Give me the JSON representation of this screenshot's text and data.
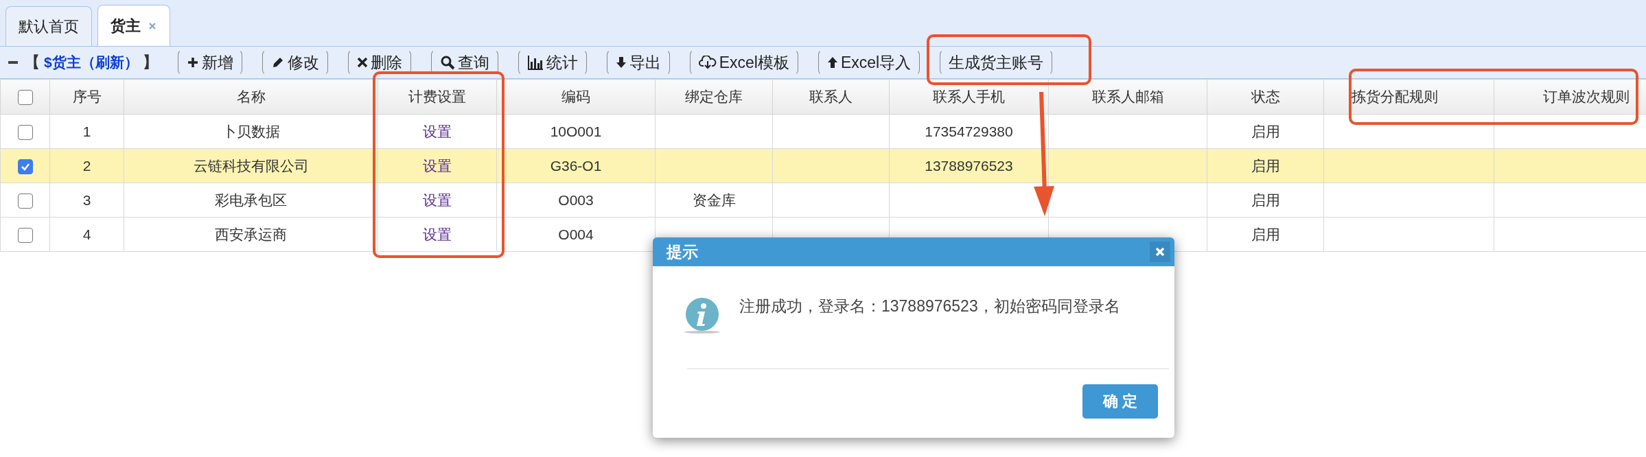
{
  "tabs": [
    {
      "label": "默认首页",
      "selected": false,
      "closable": false
    },
    {
      "label": "货主",
      "selected": true,
      "closable": true
    }
  ],
  "toolbar": {
    "title_open": "【",
    "title": "$货主（刷新）",
    "title_close": "】",
    "buttons": [
      {
        "label": "新增",
        "kind": "plus"
      },
      {
        "label": "修改",
        "kind": "pencil"
      },
      {
        "label": "删除",
        "kind": "cross"
      },
      {
        "label": "查询",
        "kind": "search"
      },
      {
        "label": "统计",
        "kind": "chart"
      },
      {
        "label": "导出",
        "kind": "down"
      },
      {
        "label": "Excel模板",
        "kind": "cloud"
      },
      {
        "label": "Excel导入",
        "kind": "up"
      },
      {
        "label": "生成货主账号",
        "kind": "plain"
      }
    ]
  },
  "table": {
    "header_checkbox": {
      "checked": false
    },
    "columns": [
      "序号",
      "名称",
      "计费设置",
      "编码",
      "绑定仓库",
      "联系人",
      "联系人手机",
      "联系人邮箱",
      "状态",
      "拣货分配规则",
      "订单波次规则"
    ],
    "rows": [
      {
        "selected": false,
        "cells": [
          "1",
          "卜贝数据",
          "设置",
          "10O001",
          null,
          null,
          "17354729380",
          null,
          "启用",
          null,
          null
        ]
      },
      {
        "selected": true,
        "cells": [
          "2",
          "云链科技有限公司",
          "设置",
          "G36-O1",
          null,
          null,
          "13788976523",
          null,
          "启用",
          null,
          null
        ]
      },
      {
        "selected": false,
        "cells": [
          "3",
          "彩电承包区",
          "设置",
          "O003",
          "资金库",
          null,
          null,
          null,
          "启用",
          null,
          null
        ]
      },
      {
        "selected": false,
        "cells": [
          "4",
          "西安承运商",
          "设置",
          "O004",
          null,
          null,
          null,
          null,
          "启用",
          null,
          null
        ]
      }
    ]
  },
  "dialog": {
    "title": "提示",
    "kind": "info",
    "message": "注册成功，登录名：13788976523，初始密码同登录名",
    "button": "确 定"
  }
}
